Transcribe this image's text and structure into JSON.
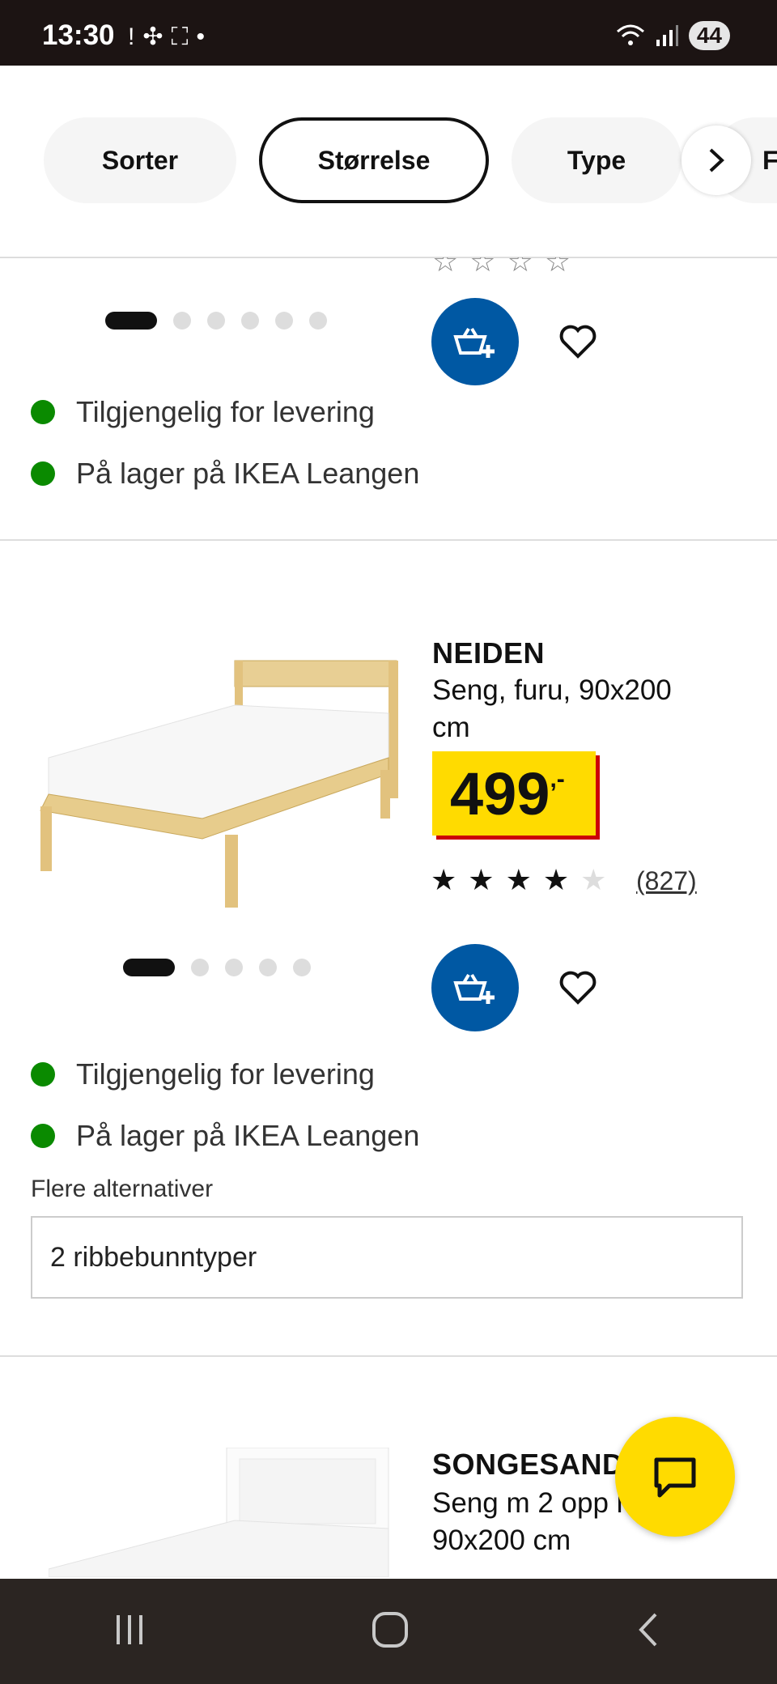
{
  "status_bar": {
    "time": "13:30",
    "battery": "44",
    "notification_icons": [
      "notification-alert-icon",
      "fan-icon",
      "screenshot-icon",
      "dot-icon"
    ],
    "system_icons": [
      "wifi-icon",
      "signal-icon"
    ]
  },
  "filters": {
    "chips": [
      {
        "label": "Sorter",
        "active": false
      },
      {
        "label": "Størrelse",
        "active": true
      },
      {
        "label": "Type",
        "active": false
      },
      {
        "label": "F",
        "active": false
      }
    ],
    "next_icon": "chevron-right-icon"
  },
  "card_prev": {
    "image_dots": 6,
    "active_dot": 0,
    "availability": [
      "Tilgjengelig for levering",
      "På lager på IKEA Leangen"
    ]
  },
  "card_neiden": {
    "name": "NEIDEN",
    "description": "Seng, furu, 90x200 cm",
    "price": {
      "integer": "499",
      "suffix": ",-"
    },
    "rating": 4,
    "rating_max": 5,
    "reviews": "(827)",
    "image_dots": 5,
    "active_dot": 0,
    "availability": [
      "Tilgjengelig for levering",
      "På lager på IKEA Leangen"
    ],
    "alternatives_label": "Flere alternativer",
    "alternatives_value": "2 ribbebunntyper"
  },
  "card_songesand": {
    "name": "SONGESAND",
    "description": "Seng m 2 opp hvit, 90x200 cm"
  },
  "colors": {
    "ikea_blue": "#0058a3",
    "price_yellow": "#ffdb00",
    "price_red": "#cc0008",
    "stock_green": "#0a8a00"
  },
  "nav_bar": {
    "icons": [
      "recent-apps-icon",
      "home-icon",
      "back-icon"
    ]
  }
}
